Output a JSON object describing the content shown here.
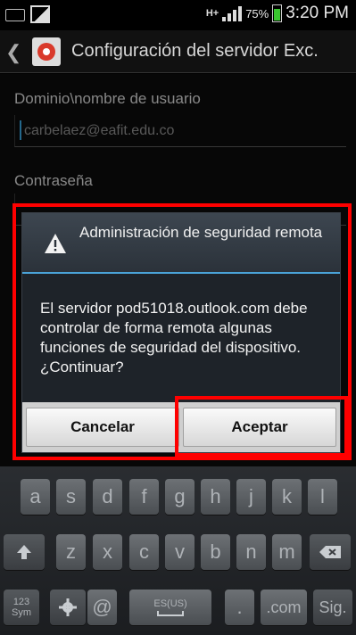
{
  "status_bar": {
    "network": "H+",
    "battery_pct": "75%",
    "time": "3:20 PM",
    "icons": [
      "keyboard-icon",
      "gallery-icon",
      "signal-icon",
      "battery-icon"
    ]
  },
  "action_bar": {
    "title": "Configuración del servidor Exc."
  },
  "form": {
    "domain_label": "Dominio\\nombre de usuario",
    "domain_value": "carbelaez@eafit.edu.co",
    "password_label": "Contraseña"
  },
  "dialog": {
    "title": "Administración de seguridad remota",
    "body": "El servidor pod51018.outlook.com debe controlar de forma remota algunas funciones de seguridad del dispositivo. ¿Continuar?",
    "cancel_label": "Cancelar",
    "accept_label": "Aceptar"
  },
  "keyboard": {
    "row2": [
      "a",
      "s",
      "d",
      "f",
      "g",
      "h",
      "j",
      "k",
      "l"
    ],
    "row3": [
      "z",
      "x",
      "c",
      "v",
      "b",
      "n",
      "m"
    ],
    "sym_label": "123\nSym",
    "at_label": "@",
    "space_label": "ES(US)",
    "period_label": ".",
    "com_label": ".com",
    "next_label": "Sig."
  },
  "colors": {
    "highlight": "#ff0000",
    "accent": "#4aa3d8"
  }
}
